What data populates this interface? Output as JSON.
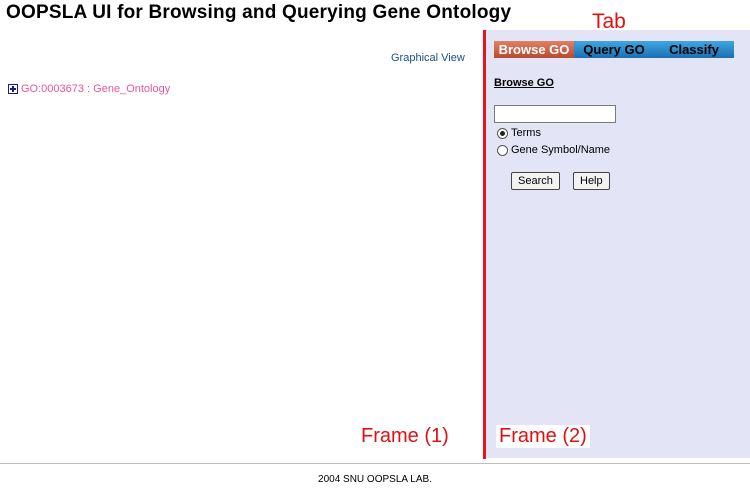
{
  "header": {
    "title": "OOPSLA UI for Browsing and Querying Gene Ontology"
  },
  "annotations": {
    "tab": "Tab",
    "frame1": "Frame (1)",
    "frame2": "Frame (2)"
  },
  "left_frame": {
    "graphical_view_link": "Graphical View",
    "tree": [
      {
        "label": "GO:0003673 : Gene_Ontology",
        "icon": "expand-plus-icon"
      }
    ]
  },
  "right_frame": {
    "tabs": [
      {
        "label": "Browse GO",
        "active": true
      },
      {
        "label": "Query GO",
        "active": false
      },
      {
        "label": "Classify",
        "active": false
      }
    ],
    "section_title": "Browse GO",
    "search_input": {
      "value": "",
      "placeholder": ""
    },
    "radio_options": [
      {
        "label": "Terms",
        "checked": true
      },
      {
        "label": "Gene Symbol/Name",
        "checked": false
      }
    ],
    "buttons": {
      "search": "Search",
      "help": "Help"
    }
  },
  "footer": {
    "text": "2004 SNU OOPSLA LAB."
  },
  "colors": {
    "annotation_red": "#e01010",
    "tree_link_pink": "#e8559a",
    "link_blue": "#1a4f8a",
    "active_tab": "#c65a3c",
    "inactive_tab": "#2a87cc",
    "right_frame_bg": "#e4e4f7"
  }
}
